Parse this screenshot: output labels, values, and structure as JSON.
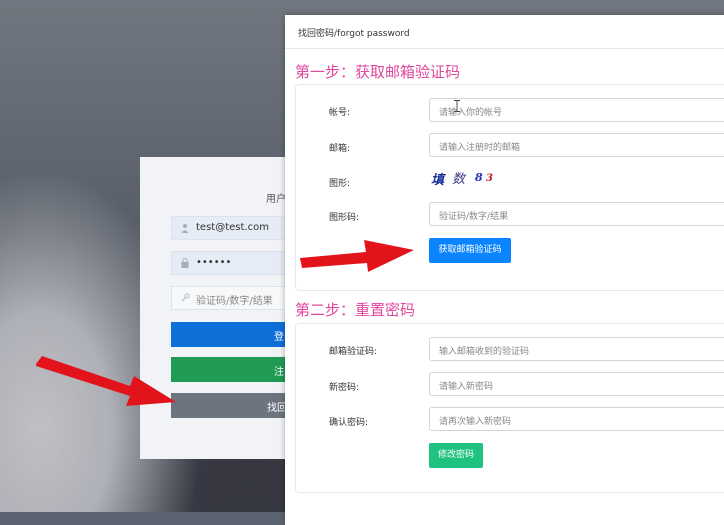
{
  "modal": {
    "title": "找回密码/forgot password",
    "step1": {
      "title": "第一步：获取邮箱验证码",
      "account_label": "帐号:",
      "account_placeholder": "请输入你的帐号",
      "email_label": "邮箱:",
      "email_placeholder": "请输入注册时的邮箱",
      "captcha_label": "图形:",
      "captcha_chars": [
        "填",
        "数",
        "8",
        "3"
      ],
      "captcha_code_label": "图形码:",
      "captcha_code_placeholder": "验证码/数字/结果",
      "get_code_button": "获取邮箱验证码"
    },
    "step2": {
      "title": "第二步：重置密码",
      "email_code_label": "邮箱验证码:",
      "email_code_placeholder": "输入邮箱收到的验证码",
      "new_password_label": "新密码:",
      "new_password_placeholder": "请输入新密码",
      "confirm_password_label": "确认密码:",
      "confirm_password_placeholder": "请再次输入新密码",
      "submit_button": "修改密码"
    }
  },
  "login": {
    "title": "用户",
    "username_value": "test@test.com",
    "password_value": "••••••",
    "captcha_placeholder": "验证码/数字/结果",
    "login_button": "登",
    "register_button": "注",
    "forgot_button": "找回"
  },
  "colors": {
    "step_title": "#e0479e",
    "primary_button": "#0a84ff",
    "success_button": "#1fc37f",
    "login_button": "#0d6fd8",
    "register_button": "#1f9b55",
    "forgot_button": "#6c757d",
    "annotation_arrow": "#e3131b"
  },
  "icons": [
    "user-icon",
    "lock-icon",
    "key-icon",
    "red-arrow-icon",
    "text-cursor-icon"
  ]
}
